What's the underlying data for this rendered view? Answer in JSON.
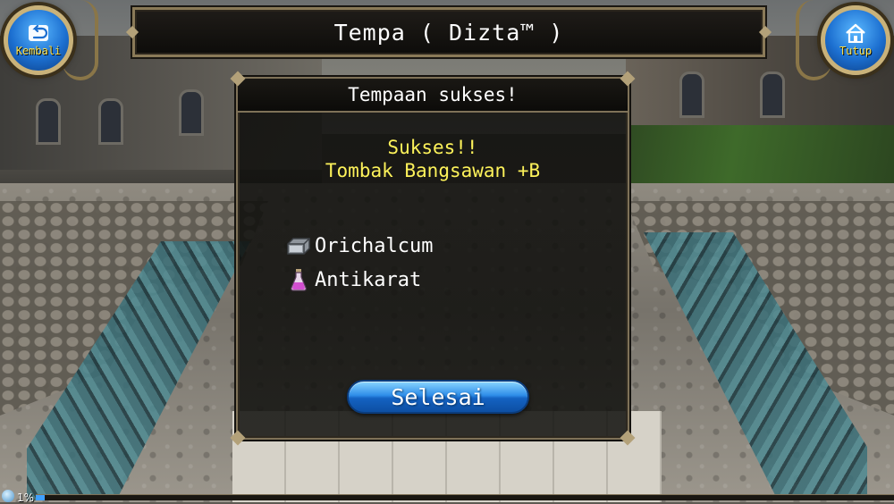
{
  "header": {
    "title": "Tempa ( Dizta™ )",
    "back_button": {
      "label": "Kembali",
      "icon": "back-arrow-icon"
    },
    "close_button": {
      "label": "Tutup",
      "icon": "home-icon"
    }
  },
  "dialog": {
    "title": "Tempaan sukses!",
    "result_status": "Sukses!!",
    "result_item": "Tombak Bangsawan +B",
    "materials": [
      {
        "name": "Orichalcum",
        "icon": "ore-icon"
      },
      {
        "name": "Antikarat",
        "icon": "potion-icon"
      }
    ],
    "done_button": "Selesai"
  },
  "status_bar": {
    "progress_text": "1%",
    "progress_percent": 1
  },
  "colors": {
    "result_text": "#fdf25a",
    "button_blue": "#2f8ee9",
    "frame_gold": "#8a7a58",
    "nav_label": "#ffe14a"
  }
}
